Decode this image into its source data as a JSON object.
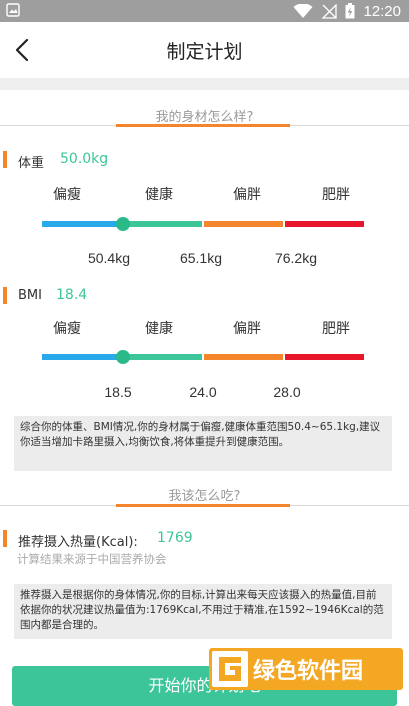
{
  "status_bar": {
    "time": "12:20"
  },
  "header": {
    "title": "制定计划"
  },
  "body_section": {
    "title": "我的身材怎么样?",
    "weight": {
      "label": "体重",
      "value": "50.0kg",
      "categories": [
        "偏瘦",
        "健康",
        "偏胖",
        "肥胖"
      ],
      "thresholds": [
        "50.4kg",
        "65.1kg",
        "76.2kg"
      ]
    },
    "bmi": {
      "label": "BMI",
      "value": "18.4",
      "categories": [
        "偏瘦",
        "健康",
        "偏胖",
        "肥胖"
      ],
      "thresholds": [
        "18.5",
        "24.0",
        "28.0"
      ]
    },
    "summary": "综合你的体重、BMI情况,你的身材属于偏瘦,健康体重范围50.4~65.1kg,建议你适当增加卡路里摄入,均衡饮食,将体重提升到健康范围。"
  },
  "diet_section": {
    "title": "我该怎么吃?",
    "intake_label": "推荐摄入热量(Kcal):",
    "intake_value": "1769",
    "source": "计算结果来源于中国营养协会",
    "explanation": "推荐摄入是根据你的身体情况,你的目标,计算出来每天应该摄入的热量值,目前依据你的状况建议热量值为:1769Kcal,不用过于精准,在1592~1946Kcal的范围内都是合理的。"
  },
  "start_button": {
    "label": "开始你的计划吧"
  },
  "watermark": {
    "text": "绿色软件园"
  },
  "scale_colors": {
    "thin": "#29a9ea",
    "healthy": "#3dc59a",
    "overweight": "#f5852a",
    "obese": "#e8162b"
  }
}
